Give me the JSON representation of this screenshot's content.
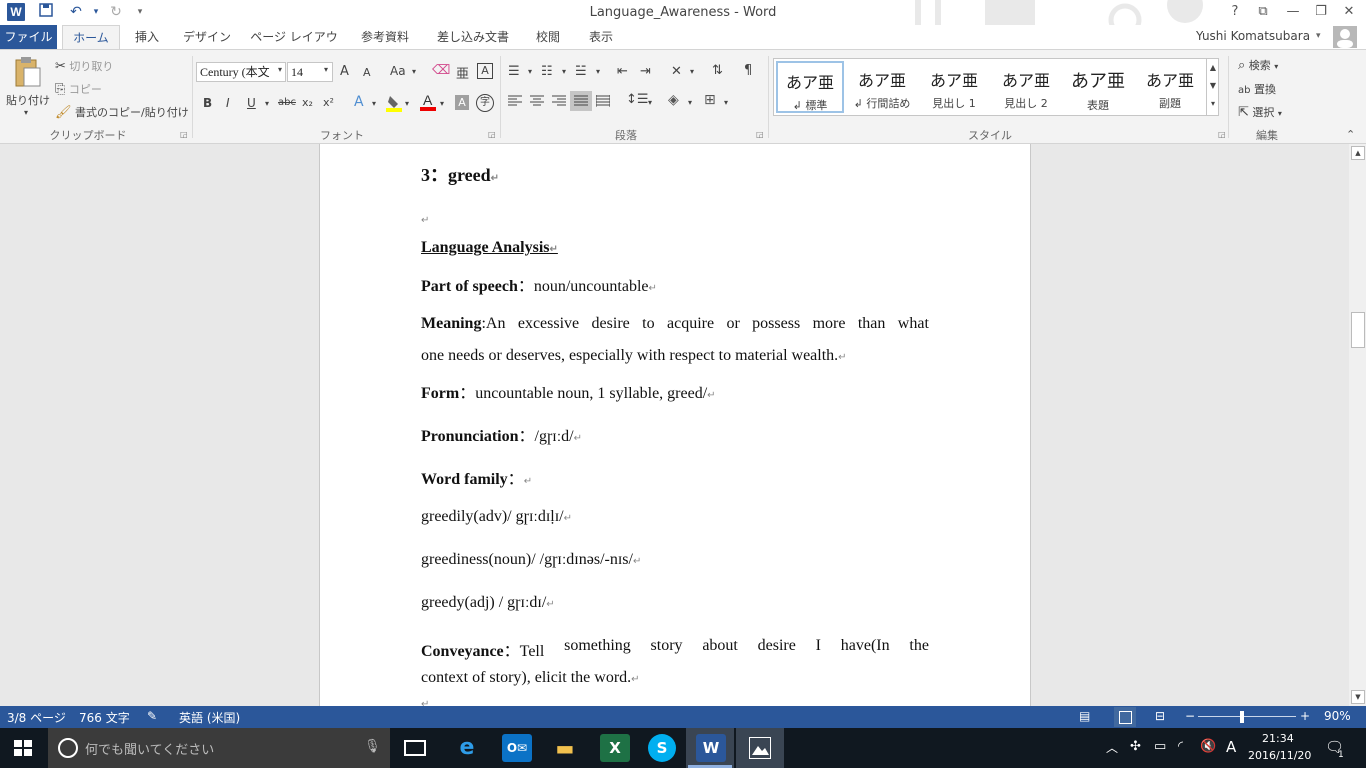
{
  "app": {
    "window_title": "Language_Awareness - Word",
    "quick_access": {
      "word_logo": "W",
      "save_icon": "save-icon",
      "undo_icon": "undo-icon",
      "redo_icon": "redo-icon"
    },
    "window_controls": {
      "help": "?",
      "ribbon_display": "⧉",
      "minimize": "—",
      "restore": "❐",
      "close": "✕"
    }
  },
  "tabs": [
    "ファイル",
    "ホーム",
    "挿入",
    "デザイン",
    "ページ レイアウト",
    "参考資料",
    "差し込み文書",
    "校閲",
    "表示"
  ],
  "active_tab": "ホーム",
  "user": {
    "name": "Yushi Komatsubara"
  },
  "ribbon": {
    "clipboard": {
      "paste": "貼り付け",
      "cut": "切り取り",
      "copy": "コピー",
      "format_painter": "書式のコピー/貼り付け",
      "group_label": "クリップボード"
    },
    "font": {
      "font_name": "Century (本文",
      "font_size": "14",
      "group_label": "フォント",
      "buttons": {
        "grow": "A",
        "shrink": "A",
        "case": "Aa",
        "bold": "B",
        "italic": "I",
        "underline": "U",
        "strike": "abc",
        "subscript": "x₂",
        "superscript": "x²"
      }
    },
    "paragraph": {
      "group_label": "段落"
    },
    "styles": {
      "group_label": "スタイル",
      "items": [
        {
          "preview": "あア亜",
          "name": "↲ 標準"
        },
        {
          "preview": "あア亜",
          "name": "↲ 行間詰め"
        },
        {
          "preview": "あア亜",
          "name": "見出し 1"
        },
        {
          "preview": "あア亜",
          "name": "見出し 2"
        },
        {
          "preview": "あア亜",
          "name": "表題"
        },
        {
          "preview": "あア亜",
          "name": "副題"
        }
      ]
    },
    "editing": {
      "find": "検索",
      "replace": "置換",
      "select": "選択",
      "group_label": "編集"
    }
  },
  "document": {
    "heading": "3：greed",
    "section_title": "Language Analysis",
    "part_of_speech": {
      "label": "Part of speech",
      "value": "：noun/uncountable"
    },
    "meaning": {
      "label": "Meaning",
      "line1_words": [
        ":An",
        "excessive",
        "desire",
        "to",
        "acquire",
        "or",
        "possess",
        "more",
        "than",
        "what"
      ],
      "line2": "one needs or deserves, especially with respect to material wealth."
    },
    "form": {
      "label": "Form",
      "value": "：uncountable noun, 1 syllable, greed/"
    },
    "pronunciation": {
      "label": "Pronunciation",
      "value": "：/gɼɪːd/"
    },
    "word_family": {
      "label": "Word family",
      "value": "："
    },
    "family_items": [
      "greedily(adv)/ gɼɪːdɪḷɪ/",
      "greediness(noun)/ /gɼɪːdɪnəs/-nɪs/",
      "greedy(adj) / gɼɪːdɪ/"
    ],
    "conveyance": {
      "label": "Conveyance",
      "line1_words": [
        "：Tell",
        "something",
        "story",
        "about",
        "desire",
        "I",
        "have(In",
        "the"
      ],
      "line2": "context of story), elicit the word."
    },
    "para_mark": "↵"
  },
  "status_bar": {
    "page": "3/8 ページ",
    "words": "766 文字",
    "language": "英語 (米国)",
    "zoom": "90%"
  },
  "taskbar": {
    "search_placeholder": "何でも聞いてください",
    "time": "21:34",
    "date": "2016/11/20",
    "ime": "A",
    "notifications": "1"
  }
}
